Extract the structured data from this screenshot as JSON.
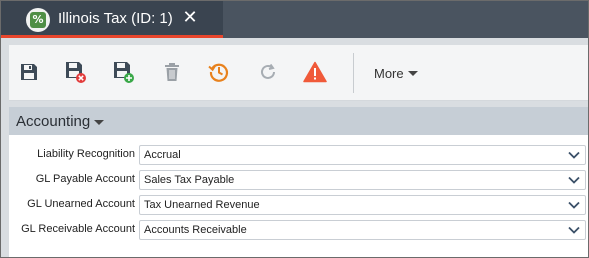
{
  "window": {
    "tab_title": "Illinois Tax (ID: 1)",
    "close_glyph": "✕",
    "app_icon_glyph": "%",
    "accent_color": "#e8452c"
  },
  "toolbar": {
    "buttons": [
      {
        "name": "save-button",
        "icon": "floppy-disk-icon"
      },
      {
        "name": "save-and-close-button",
        "icon": "floppy-disk-close-icon"
      },
      {
        "name": "save-and-new-button",
        "icon": "floppy-disk-add-icon"
      },
      {
        "name": "delete-button",
        "icon": "trash-icon"
      },
      {
        "name": "history-button",
        "icon": "history-clock-icon"
      },
      {
        "name": "refresh-button",
        "icon": "refresh-icon"
      },
      {
        "name": "alert-button",
        "icon": "warning-triangle-icon"
      }
    ],
    "more_label": "More"
  },
  "section": {
    "title": "Accounting"
  },
  "form": {
    "fields": [
      {
        "label": "Liability Recognition",
        "value": "Accrual"
      },
      {
        "label": "GL Payable Account",
        "value": "Sales Tax Payable"
      },
      {
        "label": "GL Unearned Account",
        "value": "Tax Unearned Revenue"
      },
      {
        "label": "GL Receivable Account",
        "value": "Accounts Receivable"
      }
    ]
  }
}
